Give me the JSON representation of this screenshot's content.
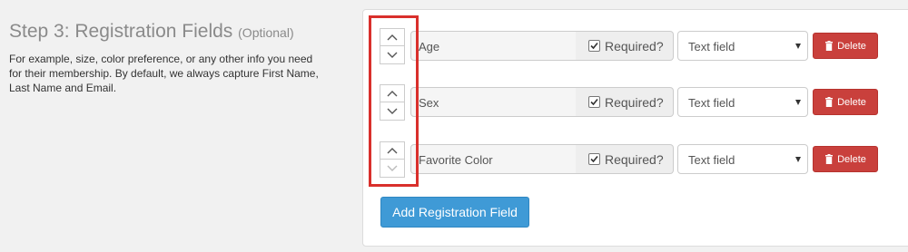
{
  "section": {
    "title": "Step 3: Registration Fields",
    "optional": "(Optional)",
    "description": "For example, size, color preference, or any other info you need for their membership. By default, we always capture First Name, Last Name and Email."
  },
  "fields": [
    {
      "name": "Age",
      "required_label": "Required?",
      "required": true,
      "type": "Text field",
      "delete_label": "Delete",
      "up_enabled": true,
      "down_enabled": true
    },
    {
      "name": "Sex",
      "required_label": "Required?",
      "required": true,
      "type": "Text field",
      "delete_label": "Delete",
      "up_enabled": true,
      "down_enabled": true
    },
    {
      "name": "Favorite Color",
      "required_label": "Required?",
      "required": true,
      "type": "Text field",
      "delete_label": "Delete",
      "up_enabled": true,
      "down_enabled": false
    }
  ],
  "add_button_label": "Add Registration Field",
  "colors": {
    "delete": "#c9403c",
    "add": "#3f9ad6",
    "highlight": "#d9302c"
  },
  "icons": {
    "up": "chevron-up-icon",
    "down": "chevron-down-icon",
    "delete": "trash-icon",
    "check": "checkmark-icon"
  }
}
